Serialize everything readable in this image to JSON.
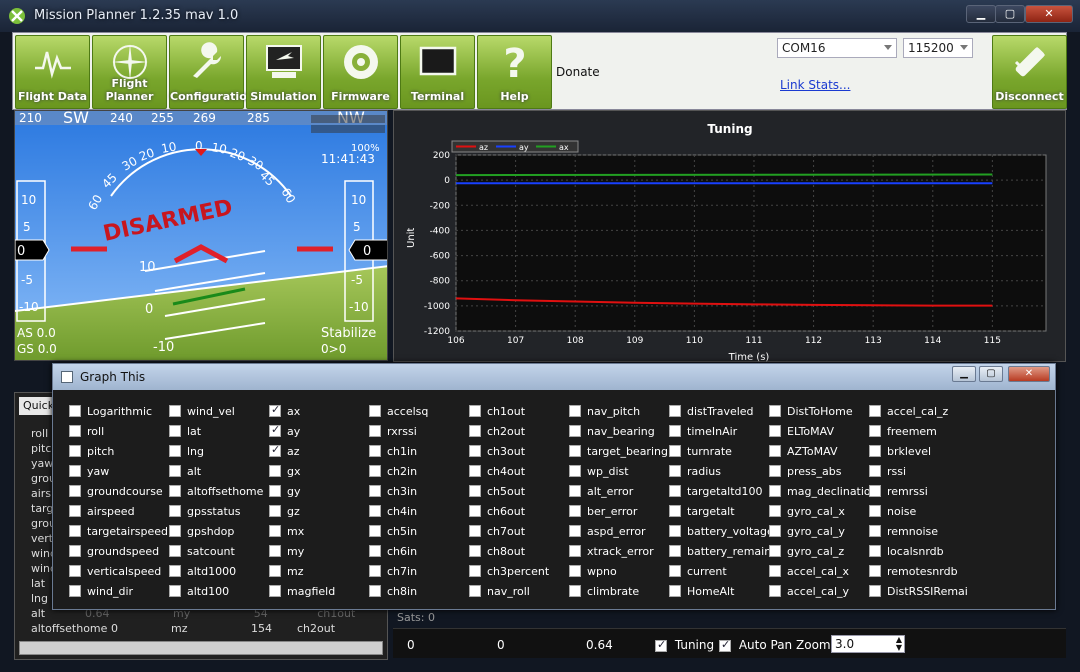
{
  "window": {
    "title": "Mission Planner 1.2.35 mav 1.0"
  },
  "toolbar": {
    "buttons": [
      {
        "label": "Flight Data",
        "icon": "flight-data-icon"
      },
      {
        "label": "Flight Planner",
        "icon": "flight-planner-icon"
      },
      {
        "label": "Configuration",
        "icon": "wrench-icon"
      },
      {
        "label": "Simulation",
        "icon": "simulation-icon"
      },
      {
        "label": "Firmware",
        "icon": "firmware-disc-icon"
      },
      {
        "label": "Terminal",
        "icon": "terminal-icon"
      },
      {
        "label": "Help",
        "icon": "help-icon"
      },
      {
        "label": "Disconnect",
        "icon": "disconnect-plug-icon"
      }
    ],
    "donate": "Donate",
    "port": "COM16",
    "baud": "115200",
    "link_stats": "Link Stats..."
  },
  "hud": {
    "heading_ticks": [
      "210",
      "SW",
      "240",
      "255",
      "269",
      "285",
      "NW"
    ],
    "pitch_labels": [
      "10",
      "5",
      "0",
      "-5",
      "-10"
    ],
    "left_speed": "0",
    "right_alt": "0",
    "status": "DISARMED",
    "time": "11:41:43",
    "battery": "100%",
    "as": "AS 0.0",
    "gs": "GS 0.0",
    "mode": "Stabilize",
    "wp": "0>0",
    "roll_scale": [
      "60",
      "45",
      "30",
      "20",
      "10",
      "0",
      "10",
      "20",
      "30",
      "45",
      "60"
    ]
  },
  "quick": {
    "tab": "Quick",
    "labels": [
      "roll",
      "pitc",
      "yaw",
      "grou",
      "airs",
      "targ",
      "grou",
      "vert",
      "wind",
      "wind",
      "lat",
      "lng",
      "alt"
    ],
    "last_row": {
      "name": "altoffsethome",
      "value": "0",
      "field": "mz",
      "num": "154",
      "ch": "ch2out"
    },
    "faded_row": {
      "name": "alt",
      "value": "0.64",
      "field": "my",
      "num": "54",
      "ch": "ch1out"
    }
  },
  "graph": {
    "title": "Tuning",
    "ylabel": "Unit",
    "xlabel": "Time (s)"
  },
  "chart_data": {
    "type": "line",
    "title": "Tuning",
    "xlabel": "Time (s)",
    "ylabel": "Unit",
    "xlim": [
      106,
      115.9
    ],
    "ylim": [
      -1200,
      200
    ],
    "x_ticks": [
      106,
      107,
      108,
      109,
      110,
      111,
      112,
      113,
      114,
      115
    ],
    "y_ticks": [
      200,
      0,
      -200,
      -400,
      -600,
      -800,
      -1000,
      -1200
    ],
    "legend_position": "top-left",
    "series": [
      {
        "name": "az",
        "color": "#e01010",
        "x": [
          106,
          107,
          108,
          109,
          110,
          111,
          112,
          113,
          114,
          115
        ],
        "y": [
          -940,
          -955,
          -965,
          -975,
          -982,
          -988,
          -992,
          -995,
          -998,
          -998
        ]
      },
      {
        "name": "ay",
        "color": "#1840ff",
        "x": [
          106,
          115
        ],
        "y": [
          -25,
          -25
        ]
      },
      {
        "name": "ax",
        "color": "#22a022",
        "x": [
          106,
          115
        ],
        "y": [
          40,
          45
        ]
      }
    ]
  },
  "graphthis": {
    "title": "Graph This",
    "columns": [
      [
        [
          "Logarithmic",
          false
        ],
        [
          "roll",
          false
        ],
        [
          "pitch",
          false
        ],
        [
          "yaw",
          false
        ],
        [
          "groundcourse",
          false
        ],
        [
          "airspeed",
          false
        ],
        [
          "targetairspeed",
          false
        ],
        [
          "groundspeed",
          false
        ],
        [
          "verticalspeed",
          false
        ],
        [
          "wind_dir",
          false
        ]
      ],
      [
        [
          "wind_vel",
          false
        ],
        [
          "lat",
          false
        ],
        [
          "lng",
          false
        ],
        [
          "alt",
          false
        ],
        [
          "altoffsethome",
          false
        ],
        [
          "gpsstatus",
          false
        ],
        [
          "gpshdop",
          false
        ],
        [
          "satcount",
          false
        ],
        [
          "altd1000",
          false
        ],
        [
          "altd100",
          false
        ]
      ],
      [
        [
          "ax",
          true
        ],
        [
          "ay",
          true
        ],
        [
          "az",
          true
        ],
        [
          "gx",
          false
        ],
        [
          "gy",
          false
        ],
        [
          "gz",
          false
        ],
        [
          "mx",
          false
        ],
        [
          "my",
          false
        ],
        [
          "mz",
          false
        ],
        [
          "magfield",
          false
        ]
      ],
      [
        [
          "accelsq",
          false
        ],
        [
          "rxrssi",
          false
        ],
        [
          "ch1in",
          false
        ],
        [
          "ch2in",
          false
        ],
        [
          "ch3in",
          false
        ],
        [
          "ch4in",
          false
        ],
        [
          "ch5in",
          false
        ],
        [
          "ch6in",
          false
        ],
        [
          "ch7in",
          false
        ],
        [
          "ch8in",
          false
        ]
      ],
      [
        [
          "ch1out",
          false
        ],
        [
          "ch2out",
          false
        ],
        [
          "ch3out",
          false
        ],
        [
          "ch4out",
          false
        ],
        [
          "ch5out",
          false
        ],
        [
          "ch6out",
          false
        ],
        [
          "ch7out",
          false
        ],
        [
          "ch8out",
          false
        ],
        [
          "ch3percent",
          false
        ],
        [
          "nav_roll",
          false
        ]
      ],
      [
        [
          "nav_pitch",
          false
        ],
        [
          "nav_bearing",
          false
        ],
        [
          "target_bearing",
          false
        ],
        [
          "wp_dist",
          false
        ],
        [
          "alt_error",
          false
        ],
        [
          "ber_error",
          false
        ],
        [
          "aspd_error",
          false
        ],
        [
          "xtrack_error",
          false
        ],
        [
          "wpno",
          false
        ],
        [
          "climbrate",
          false
        ]
      ],
      [
        [
          "distTraveled",
          false
        ],
        [
          "timeInAir",
          false
        ],
        [
          "turnrate",
          false
        ],
        [
          "radius",
          false
        ],
        [
          "targetaltd100",
          false
        ],
        [
          "targetalt",
          false
        ],
        [
          "battery_voltage",
          false
        ],
        [
          "battery_remaini",
          false
        ],
        [
          "current",
          false
        ],
        [
          "HomeAlt",
          false
        ]
      ],
      [
        [
          "DistToHome",
          false
        ],
        [
          "ELToMAV",
          false
        ],
        [
          "AZToMAV",
          false
        ],
        [
          "press_abs",
          false
        ],
        [
          "mag_declinatio",
          false
        ],
        [
          "gyro_cal_x",
          false
        ],
        [
          "gyro_cal_y",
          false
        ],
        [
          "gyro_cal_z",
          false
        ],
        [
          "accel_cal_x",
          false
        ],
        [
          "accel_cal_y",
          false
        ]
      ],
      [
        [
          "accel_cal_z",
          false
        ],
        [
          "freemem",
          false
        ],
        [
          "brklevel",
          false
        ],
        [
          "rssi",
          false
        ],
        [
          "remrssi",
          false
        ],
        [
          "noise",
          false
        ],
        [
          "remnoise",
          false
        ],
        [
          "localsnrdb",
          false
        ],
        [
          "remotesnrdb",
          false
        ],
        [
          "DistRSSIRemai",
          false
        ]
      ]
    ]
  },
  "bottom": {
    "v1": "0",
    "v2": "0",
    "v3": "0.64",
    "tuning": "Tuning",
    "tuning_checked": true,
    "autopan": "Auto Pan",
    "autopan_checked": true,
    "zoom_label": "Zoom",
    "zoom": "3.0",
    "sats": "Sats: 0"
  }
}
